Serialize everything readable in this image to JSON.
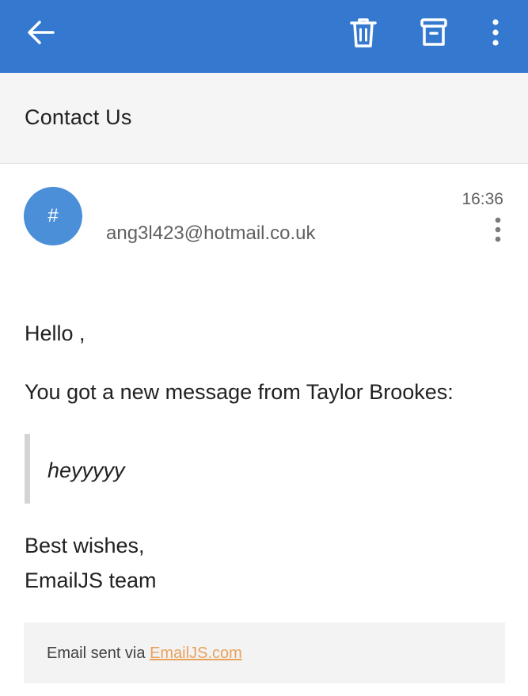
{
  "toolbar": {
    "back_icon": "arrow-left-icon",
    "delete_icon": "trash-icon",
    "archive_icon": "archive-icon",
    "menu_icon": "more-vertical-icon",
    "background_color": "#3478cf"
  },
  "email": {
    "subject": "Contact Us",
    "avatar_initial": "#",
    "avatar_color": "#4a8fd8",
    "sender": "ang3l423@hotmail.co.uk",
    "time": "16:36",
    "greeting": "Hello ,",
    "intro": "You got a new message from Taylor Brookes:",
    "quote": "heyyyyy",
    "signoff": "Best wishes,",
    "team": "EmailJS team"
  },
  "footer": {
    "prefix": "Email sent via ",
    "link_text": "EmailJS.com",
    "link_color": "#e8a25c"
  }
}
